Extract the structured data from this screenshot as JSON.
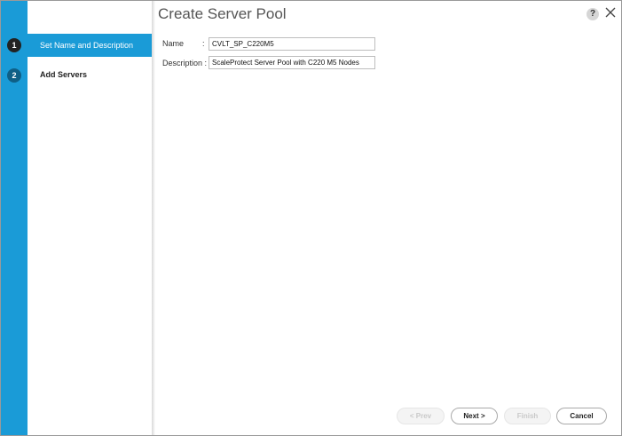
{
  "wizard": {
    "title": "Create Server Pool",
    "help_glyph": "?",
    "steps": [
      {
        "number": "1",
        "label": "Set Name and Description",
        "active": true
      },
      {
        "number": "2",
        "label": "Add Servers",
        "active": false
      }
    ]
  },
  "form": {
    "name_label": "Name",
    "name_colon": ":",
    "name_value": "CVLT_SP_C220M5",
    "description_label": "Description :",
    "description_value": "ScaleProtect Server Pool with C220 M5 Nodes"
  },
  "footer": {
    "prev_label": "< Prev",
    "next_label": "Next >",
    "finish_label": "Finish",
    "cancel_label": "Cancel"
  },
  "colors": {
    "accent": "#1a9bd7",
    "active_step_number_bg": "#222222",
    "inactive_step_number_bg": "#0f5f86"
  },
  "icons": {
    "help": "help-icon",
    "close": "close-icon"
  }
}
